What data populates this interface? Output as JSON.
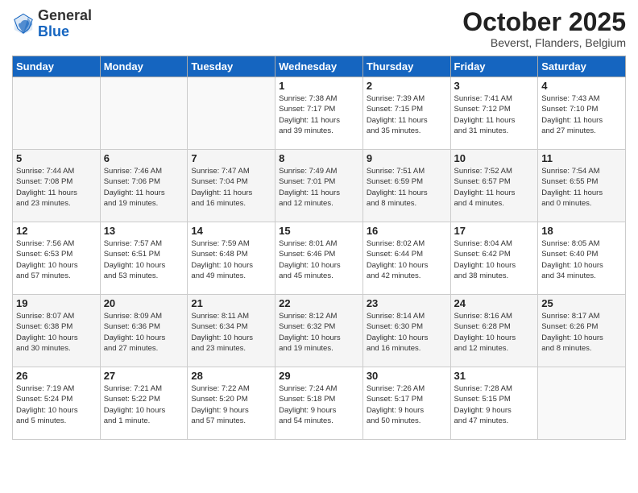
{
  "header": {
    "logo_general": "General",
    "logo_blue": "Blue",
    "month_title": "October 2025",
    "subtitle": "Beverst, Flanders, Belgium"
  },
  "days_of_week": [
    "Sunday",
    "Monday",
    "Tuesday",
    "Wednesday",
    "Thursday",
    "Friday",
    "Saturday"
  ],
  "weeks": [
    [
      {
        "day": "",
        "info": ""
      },
      {
        "day": "",
        "info": ""
      },
      {
        "day": "",
        "info": ""
      },
      {
        "day": "1",
        "info": "Sunrise: 7:38 AM\nSunset: 7:17 PM\nDaylight: 11 hours\nand 39 minutes."
      },
      {
        "day": "2",
        "info": "Sunrise: 7:39 AM\nSunset: 7:15 PM\nDaylight: 11 hours\nand 35 minutes."
      },
      {
        "day": "3",
        "info": "Sunrise: 7:41 AM\nSunset: 7:12 PM\nDaylight: 11 hours\nand 31 minutes."
      },
      {
        "day": "4",
        "info": "Sunrise: 7:43 AM\nSunset: 7:10 PM\nDaylight: 11 hours\nand 27 minutes."
      }
    ],
    [
      {
        "day": "5",
        "info": "Sunrise: 7:44 AM\nSunset: 7:08 PM\nDaylight: 11 hours\nand 23 minutes."
      },
      {
        "day": "6",
        "info": "Sunrise: 7:46 AM\nSunset: 7:06 PM\nDaylight: 11 hours\nand 19 minutes."
      },
      {
        "day": "7",
        "info": "Sunrise: 7:47 AM\nSunset: 7:04 PM\nDaylight: 11 hours\nand 16 minutes."
      },
      {
        "day": "8",
        "info": "Sunrise: 7:49 AM\nSunset: 7:01 PM\nDaylight: 11 hours\nand 12 minutes."
      },
      {
        "day": "9",
        "info": "Sunrise: 7:51 AM\nSunset: 6:59 PM\nDaylight: 11 hours\nand 8 minutes."
      },
      {
        "day": "10",
        "info": "Sunrise: 7:52 AM\nSunset: 6:57 PM\nDaylight: 11 hours\nand 4 minutes."
      },
      {
        "day": "11",
        "info": "Sunrise: 7:54 AM\nSunset: 6:55 PM\nDaylight: 11 hours\nand 0 minutes."
      }
    ],
    [
      {
        "day": "12",
        "info": "Sunrise: 7:56 AM\nSunset: 6:53 PM\nDaylight: 10 hours\nand 57 minutes."
      },
      {
        "day": "13",
        "info": "Sunrise: 7:57 AM\nSunset: 6:51 PM\nDaylight: 10 hours\nand 53 minutes."
      },
      {
        "day": "14",
        "info": "Sunrise: 7:59 AM\nSunset: 6:48 PM\nDaylight: 10 hours\nand 49 minutes."
      },
      {
        "day": "15",
        "info": "Sunrise: 8:01 AM\nSunset: 6:46 PM\nDaylight: 10 hours\nand 45 minutes."
      },
      {
        "day": "16",
        "info": "Sunrise: 8:02 AM\nSunset: 6:44 PM\nDaylight: 10 hours\nand 42 minutes."
      },
      {
        "day": "17",
        "info": "Sunrise: 8:04 AM\nSunset: 6:42 PM\nDaylight: 10 hours\nand 38 minutes."
      },
      {
        "day": "18",
        "info": "Sunrise: 8:05 AM\nSunset: 6:40 PM\nDaylight: 10 hours\nand 34 minutes."
      }
    ],
    [
      {
        "day": "19",
        "info": "Sunrise: 8:07 AM\nSunset: 6:38 PM\nDaylight: 10 hours\nand 30 minutes."
      },
      {
        "day": "20",
        "info": "Sunrise: 8:09 AM\nSunset: 6:36 PM\nDaylight: 10 hours\nand 27 minutes."
      },
      {
        "day": "21",
        "info": "Sunrise: 8:11 AM\nSunset: 6:34 PM\nDaylight: 10 hours\nand 23 minutes."
      },
      {
        "day": "22",
        "info": "Sunrise: 8:12 AM\nSunset: 6:32 PM\nDaylight: 10 hours\nand 19 minutes."
      },
      {
        "day": "23",
        "info": "Sunrise: 8:14 AM\nSunset: 6:30 PM\nDaylight: 10 hours\nand 16 minutes."
      },
      {
        "day": "24",
        "info": "Sunrise: 8:16 AM\nSunset: 6:28 PM\nDaylight: 10 hours\nand 12 minutes."
      },
      {
        "day": "25",
        "info": "Sunrise: 8:17 AM\nSunset: 6:26 PM\nDaylight: 10 hours\nand 8 minutes."
      }
    ],
    [
      {
        "day": "26",
        "info": "Sunrise: 7:19 AM\nSunset: 5:24 PM\nDaylight: 10 hours\nand 5 minutes."
      },
      {
        "day": "27",
        "info": "Sunrise: 7:21 AM\nSunset: 5:22 PM\nDaylight: 10 hours\nand 1 minute."
      },
      {
        "day": "28",
        "info": "Sunrise: 7:22 AM\nSunset: 5:20 PM\nDaylight: 9 hours\nand 57 minutes."
      },
      {
        "day": "29",
        "info": "Sunrise: 7:24 AM\nSunset: 5:18 PM\nDaylight: 9 hours\nand 54 minutes."
      },
      {
        "day": "30",
        "info": "Sunrise: 7:26 AM\nSunset: 5:17 PM\nDaylight: 9 hours\nand 50 minutes."
      },
      {
        "day": "31",
        "info": "Sunrise: 7:28 AM\nSunset: 5:15 PM\nDaylight: 9 hours\nand 47 minutes."
      },
      {
        "day": "",
        "info": ""
      }
    ]
  ]
}
